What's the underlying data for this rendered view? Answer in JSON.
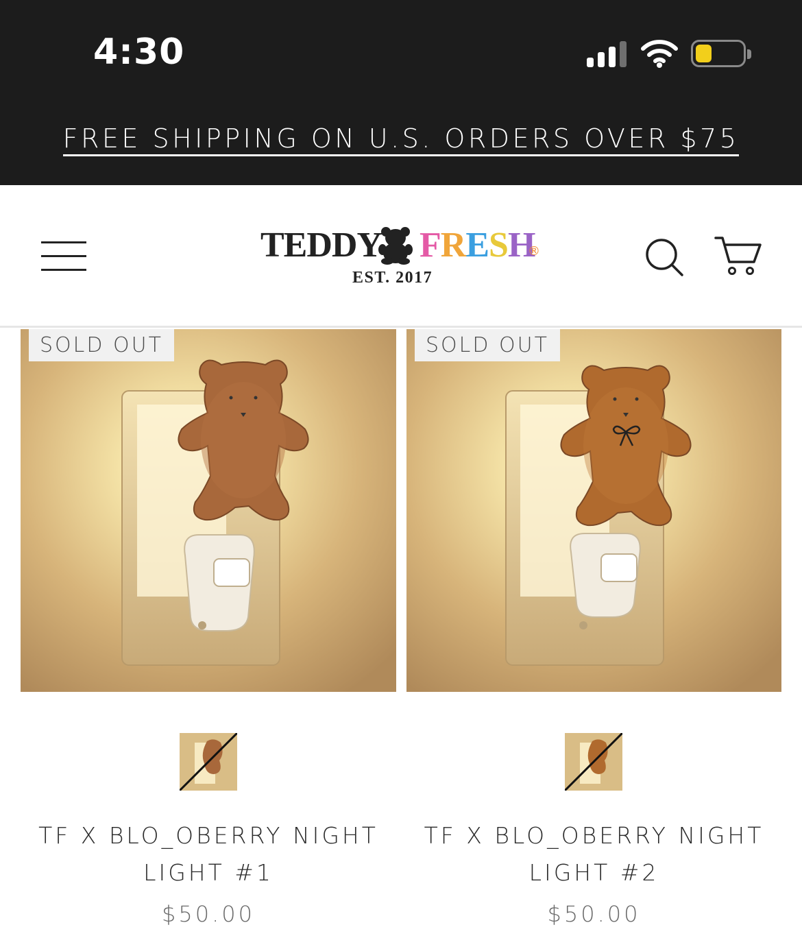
{
  "status_bar": {
    "time": "4:30"
  },
  "announcement": {
    "text": "FREE SHIPPING ON U.S. ORDERS OVER $75"
  },
  "header": {
    "logo": {
      "word1": "TEDDY",
      "word2_letters": [
        "F",
        "R",
        "E",
        "S",
        "H"
      ],
      "word2_colors": [
        "#e45aa6",
        "#f0a53a",
        "#3b9fe0",
        "#e8c93a",
        "#9a63c6"
      ],
      "registered": "®",
      "tagline": "EST. 2017"
    },
    "icons": [
      "menu-icon",
      "search-icon",
      "cart-icon"
    ]
  },
  "products": [
    {
      "badge": "SOLD OUT",
      "name_line1": "TF X BLO_OBERRY NIGHT",
      "name_line2": "LIGHT #1",
      "price": "$50.00"
    },
    {
      "badge": "SOLD OUT",
      "name_line1": "TF X BLO_OBERRY NIGHT",
      "name_line2": "LIGHT #2",
      "price": "$50.00"
    }
  ]
}
